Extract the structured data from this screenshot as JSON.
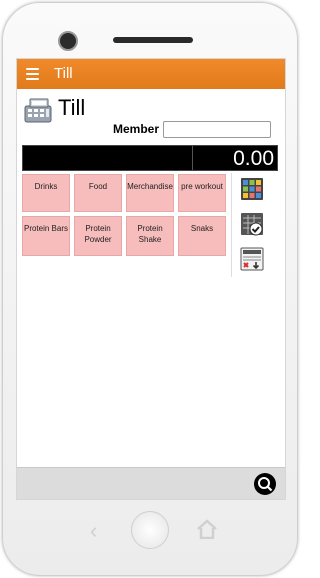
{
  "app": {
    "title": "Till"
  },
  "page": {
    "title": "Till",
    "icon": "cash-register-icon"
  },
  "member": {
    "label": "Member",
    "value": ""
  },
  "total": {
    "value": "0.00"
  },
  "categories": [
    {
      "label": "Drinks"
    },
    {
      "label": "Food"
    },
    {
      "label": "Merchandise"
    },
    {
      "label": "pre workout"
    },
    {
      "label": "Protein Bars"
    },
    {
      "label": "Protein Powder"
    },
    {
      "label": "Protein Shake"
    },
    {
      "label": "Snaks"
    }
  ],
  "side_actions": [
    {
      "icon": "grid-icon"
    },
    {
      "icon": "checked-grid-icon"
    },
    {
      "icon": "cancel-list-icon"
    }
  ],
  "colors": {
    "appbar": "#e8821f",
    "category": "#f7bcbc",
    "total_bg": "#000000"
  }
}
